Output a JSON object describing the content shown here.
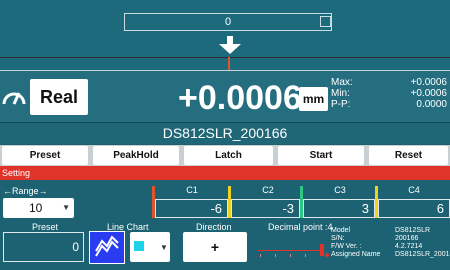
{
  "top": {
    "value": "0"
  },
  "reading": {
    "mode_label": "Real",
    "value": "+0.0006",
    "unit": "mm",
    "stats": {
      "max_label": "Max:",
      "max_value": "+0.0006",
      "min_label": "Min:",
      "min_value": "+0.0006",
      "pp_label": "P-P:",
      "pp_value": "0.0000"
    }
  },
  "device_name": "DS812SLR_200166",
  "buttons": {
    "preset": "Preset",
    "peakhold": "PeakHold",
    "latch": "Latch",
    "start": "Start",
    "reset": "Reset"
  },
  "setting": {
    "title": "Setting",
    "range_label": "←Range→",
    "range_value": "10",
    "channels": [
      {
        "label": "C1",
        "value": "-6"
      },
      {
        "label": "C2",
        "value": "-3"
      },
      {
        "label": "C3",
        "value": "3"
      },
      {
        "label": "C4",
        "value": "6"
      }
    ],
    "preset_label": "Preset",
    "preset_value": "0",
    "line_chart_label": "Line Chart",
    "direction_label": "Direction",
    "direction_value": "+",
    "decimal_label": "Decimal point :4",
    "decimal_value": 4,
    "info": {
      "model_label": "Model",
      "model_value": "DS812SLR",
      "sn_label": "S/N:",
      "sn_value": "200166",
      "fw_label": "F/W Ver. :",
      "fw_value": "4.2.7214",
      "assigned_label": "Assigned Name",
      "assigned_value": "DS812SLR_20016"
    }
  },
  "colors": {
    "accent_red": "#e0342a",
    "ch1": "#e0542a",
    "ch2": "#f0d020",
    "ch3": "#2ac880",
    "ch4": "#f0d020",
    "line_color": "#1ed2e8"
  },
  "icons": [
    "arrow-down-icon",
    "gauge-icon",
    "line-chart-icon",
    "chevron-down-icon"
  ]
}
